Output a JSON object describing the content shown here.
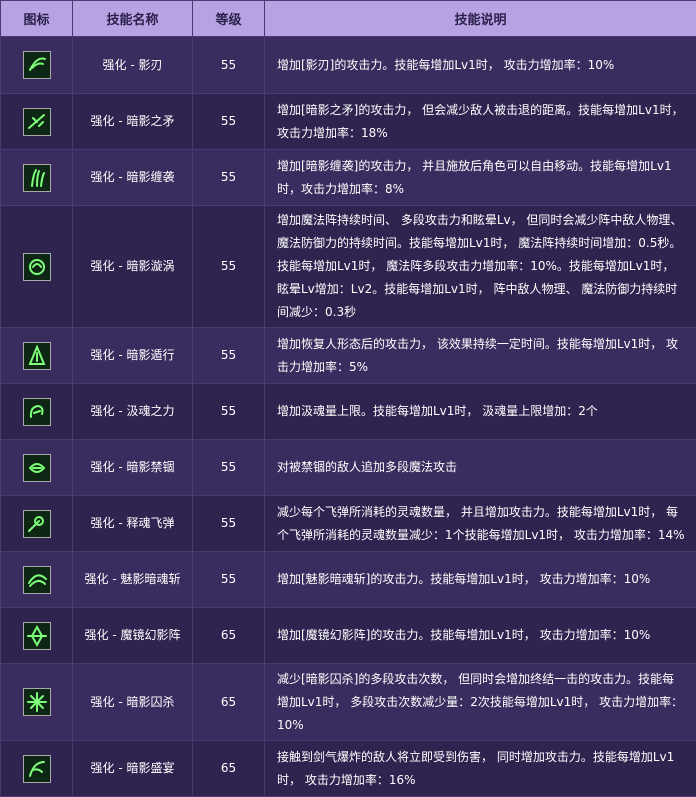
{
  "header": {
    "icon": "图标",
    "name": "技能名称",
    "level": "等级",
    "desc": "技能说明"
  },
  "rows": [
    {
      "name": "强化 - 影刃",
      "level": "55",
      "desc": "增加[影刃]的攻击力。技能每增加Lv1时， 攻击力增加率：10%",
      "icon": "shadow-blade-icon"
    },
    {
      "name": "强化 - 暗影之矛",
      "level": "55",
      "desc": "增加[暗影之矛]的攻击力， 但会减少敌人被击退的距离。技能每增加Lv1时， 攻击力增加率：18%",
      "icon": "shadow-spear-icon"
    },
    {
      "name": "强化 - 暗影缠袭",
      "level": "55",
      "desc": "增加[暗影缠袭]的攻击力， 并且施放后角色可以自由移动。技能每增加Lv1时，攻击力增加率：8%",
      "icon": "shadow-bind-icon"
    },
    {
      "name": "强化 - 暗影漩涡",
      "level": "55",
      "desc": "增加魔法阵持续时间、 多段攻击力和眩晕Lv， 但同时会减少阵中敌人物理、魔法防御力的持续时间。技能每增加Lv1时， 魔法阵持续时间增加：0.5秒。技能每增加Lv1时， 魔法阵多段攻击力增加率：10%。技能每增加Lv1时，眩晕Lv增加：Lv2。技能每增加Lv1时， 阵中敌人物理、 魔法防御力持续时间减少：0.3秒",
      "icon": "shadow-vortex-icon"
    },
    {
      "name": "强化 - 暗影遁行",
      "level": "55",
      "desc": "增加恢复人形态后的攻击力， 该效果持续一定时间。技能每增加Lv1时， 攻击力增加率：5%",
      "icon": "shadow-stealth-icon"
    },
    {
      "name": "强化 - 汲魂之力",
      "level": "55",
      "desc": "增加汲魂量上限。技能每增加Lv1时， 汲魂量上限增加：2个",
      "icon": "soul-drain-icon"
    },
    {
      "name": "强化 - 暗影禁锢",
      "level": "55",
      "desc": "对被禁锢的敌人追加多段魔法攻击",
      "icon": "shadow-prison-icon"
    },
    {
      "name": "强化 - 释魂飞弹",
      "level": "55",
      "desc": "减少每个飞弹所消耗的灵魂数量， 并且增加攻击力。技能每增加Lv1时， 每个飞弹所消耗的灵魂数量减少：1个技能每增加Lv1时， 攻击力增加率：14%",
      "icon": "soul-missile-icon"
    },
    {
      "name": "强化 - 魅影暗魂斩",
      "level": "55",
      "desc": "增加[魅影暗魂斩]的攻击力。技能每增加Lv1时， 攻击力增加率：10%",
      "icon": "phantom-slash-icon"
    },
    {
      "name": "强化 - 魔镜幻影阵",
      "level": "65",
      "desc": "增加[魔镜幻影阵]的攻击力。技能每增加Lv1时， 攻击力增加率：10%",
      "icon": "mirror-phantom-icon"
    },
    {
      "name": "强化 - 暗影囚杀",
      "level": "65",
      "desc": "减少[暗影囚杀]的多段攻击次数， 但同时会增加终结一击的攻击力。技能每增加Lv1时， 多段攻击次数减少量：2次技能每增加Lv1时， 攻击力增加率：10%",
      "icon": "shadow-execution-icon"
    },
    {
      "name": "强化 - 暗影盛宴",
      "level": "65",
      "desc": "接触到剑气爆炸的敌人将立即受到伤害， 同时增加攻击力。技能每增加Lv1时， 攻击力增加率：16%",
      "icon": "shadow-feast-icon"
    }
  ],
  "colors": {
    "header_bg": "#b7a3e3",
    "row_odd": "#3a2c5e",
    "row_even": "#2f2350",
    "icon_glow": "#7dff7a"
  }
}
